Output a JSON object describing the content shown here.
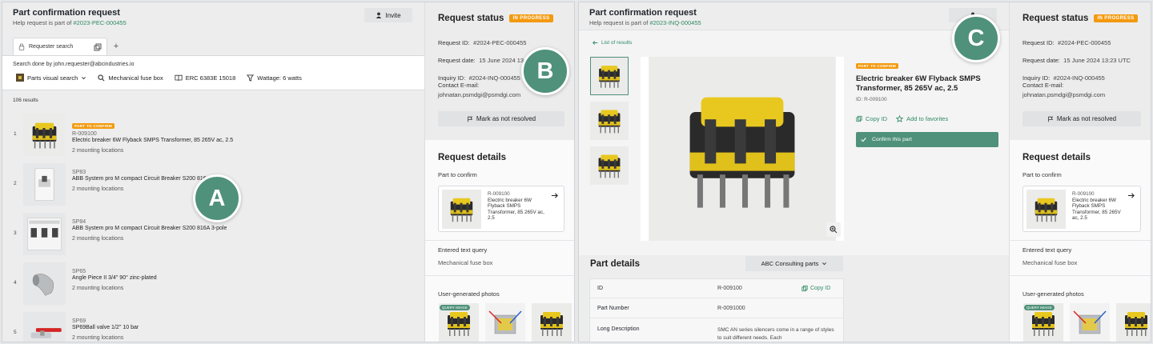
{
  "left": {
    "header": {
      "title": "Part confirmation request",
      "subtitle_prefix": "Help request is part of",
      "subtitle_link": "#2023-PEC-000455",
      "invite_label": "Invite"
    },
    "tab": {
      "label": "Requester search",
      "add_label": "+"
    },
    "search": {
      "done_by": "Search done by john.requester@abcindustries.io",
      "filters": [
        {
          "label": "Parts visual search",
          "icon": "image-icon"
        },
        {
          "label": "Mechanical fuse box",
          "icon": "search-icon"
        },
        {
          "label": "ERC 6383E 15018",
          "icon": "book-icon"
        },
        {
          "label": "Wattage: 6 watts",
          "icon": "filter-icon"
        }
      ]
    },
    "results_count": "106 results",
    "results": [
      {
        "num": "1",
        "badge": "PART TO CONFIRM",
        "code": "R-009100",
        "name": "Electric breaker 6W Flyback SMPS Transformer, 85 265V ac, 2.5",
        "locations": "2 mounting locations"
      },
      {
        "num": "2",
        "code": "SP83",
        "name": "ABB System pro M compact Circuit Breaker S200 816A 3-pole",
        "locations": "2 mounting locations"
      },
      {
        "num": "3",
        "code": "SP84",
        "name": "ABB System pro M compact Circuit Breaker S200 816A 3-pole",
        "locations": "2 mounting locations"
      },
      {
        "num": "4",
        "code": "SP65",
        "name": "Angle Piece II 3/4\" 90° zinc-plated",
        "locations": "2 mounting locations"
      },
      {
        "num": "5",
        "code": "SP69",
        "name": "SP69Ball valve 1/2'' 10 bar",
        "locations": "2 mounting locations"
      }
    ]
  },
  "side": {
    "status_title": "Request status",
    "status_badge": "IN PROGRESS",
    "request_id_label": "Request ID:",
    "request_id": "#2024-PEC-000455",
    "request_date_label": "Request date:",
    "request_date": "15 June 2024 13:23 UTC",
    "inquiry_label": "Inquiry ID:",
    "inquiry_id": "#2024-INQ-000455",
    "contact_label": "Contact E-mail:",
    "contact_email": "johnatan.psmdgi@psmdgi.com",
    "mark_button": "Mark as not resolved",
    "details_title": "Request details",
    "part_to_confirm_label": "Part to confirm",
    "part_code": "R-009100",
    "part_name": "Electric breaker 6W Flyback SMPS Transformer, 85 265V ac, 2.5",
    "text_query_label": "Entered text query",
    "text_query": "Mechanical fuse box",
    "photos_label": "User-generated photos",
    "query_image_tag": "QUERY IMAGE"
  },
  "right": {
    "header": {
      "title": "Part confirmation request",
      "subtitle_prefix": "Help request is part of",
      "subtitle_link": "#2023-INQ-000455"
    },
    "back_link": "List of results",
    "badge": "PART TO CONFIRM",
    "part_title": "Electric breaker 6W Flyback SMPS Transformer, 85 265V ac, 2.5",
    "part_id": "ID: R-009100",
    "copy_id": "Copy ID",
    "add_favorites": "Add to favorites",
    "confirm_button": "Confirm this part",
    "part_details_title": "Part details",
    "dropdown": "ABC Consulting parts",
    "table": [
      {
        "key": "ID",
        "value": "R-009100",
        "action": "Copy ID"
      },
      {
        "key": "Part Number",
        "value": "R-0091000"
      },
      {
        "key": "Long Description",
        "value": "SMC AN series silencers come in a range of styles to suit different needs. Each"
      }
    ]
  },
  "markers": {
    "a": "A",
    "b": "B",
    "c": "C"
  }
}
